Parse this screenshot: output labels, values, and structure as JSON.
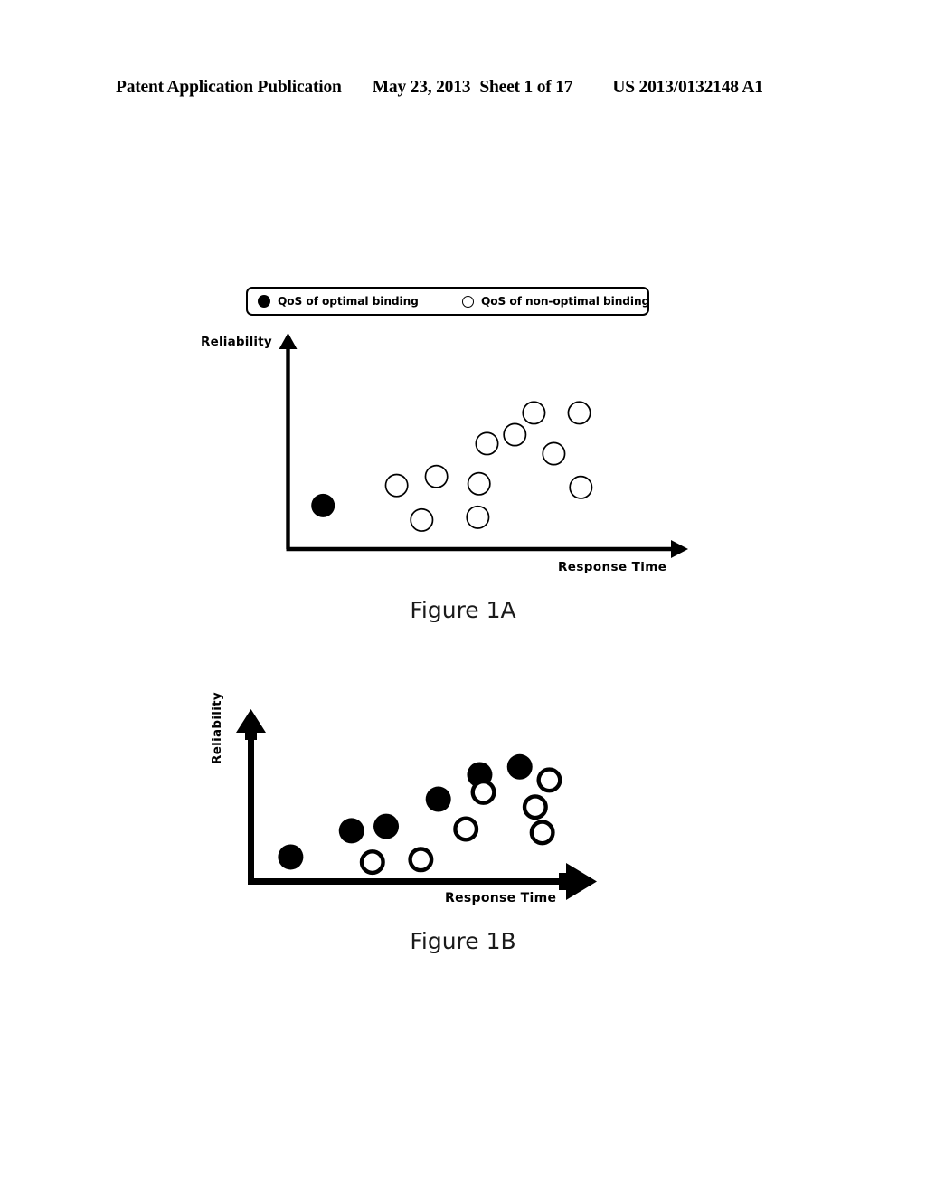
{
  "header": {
    "publication": "Patent Application Publication",
    "date": "May 23, 2013",
    "sheet": "Sheet 1 of 17",
    "patent_number": "US 2013/0132148 A1"
  },
  "legend": {
    "optimal_label": "QoS of optimal binding",
    "non_optimal_label": "QoS of non-optimal binding",
    "optimal_marker": "filled-circle",
    "non_optimal_marker": "open-circle"
  },
  "figures": [
    {
      "caption": "Figure 1A",
      "xlabel": "Response Time",
      "ylabel": "Reliability"
    },
    {
      "caption": "Figure 1B",
      "xlabel": "Response   Time",
      "ylabel": "Reliability"
    }
  ],
  "colors": {
    "ink": "#000000",
    "paper": "#ffffff"
  },
  "chart_data": [
    {
      "type": "scatter",
      "title": "Figure 1A",
      "xlabel": "Response Time",
      "ylabel": "Reliability",
      "grid": false,
      "axes": {
        "style": "arrow",
        "ticks": false,
        "xlim": [
          0,
          100
        ],
        "ylim": [
          0,
          100
        ]
      },
      "legend_position": "above-plot",
      "marker_radius_px": 13,
      "series": [
        {
          "name": "QoS of optimal binding",
          "marker": "filled-circle",
          "points": [
            {
              "x": 8.8,
              "y": 20.4
            }
          ]
        },
        {
          "name": "QoS of non-optimal binding",
          "marker": "open-circle",
          "points": [
            {
              "x": 27.3,
              "y": 29.8
            },
            {
              "x": 37.3,
              "y": 34.0
            },
            {
              "x": 33.6,
              "y": 13.6
            },
            {
              "x": 48.0,
              "y": 30.6
            },
            {
              "x": 47.7,
              "y": 14.9
            },
            {
              "x": 50.0,
              "y": 49.4
            },
            {
              "x": 57.0,
              "y": 53.6
            },
            {
              "x": 61.8,
              "y": 63.8
            },
            {
              "x": 66.8,
              "y": 44.7
            },
            {
              "x": 73.2,
              "y": 63.8
            },
            {
              "x": 73.6,
              "y": 28.9
            }
          ]
        }
      ]
    },
    {
      "type": "scatter",
      "title": "Figure 1B",
      "xlabel": "Response   Time",
      "ylabel": "Reliability",
      "grid": false,
      "axes": {
        "style": "arrow-bold",
        "ticks": false,
        "xlim": [
          0,
          100
        ],
        "ylim": [
          0,
          100
        ]
      },
      "legend_position": "none",
      "marker_radius_px": 14,
      "series": [
        {
          "name": "QoS of optimal binding",
          "marker": "filled-circle",
          "points": [
            {
              "x": 11.8,
              "y": 15.2
            },
            {
              "x": 29.9,
              "y": 31.5
            },
            {
              "x": 40.2,
              "y": 34.2
            },
            {
              "x": 55.7,
              "y": 51.1
            },
            {
              "x": 68.0,
              "y": 66.3
            },
            {
              "x": 79.9,
              "y": 71.2
            }
          ]
        },
        {
          "name": "QoS of non-optimal binding",
          "marker": "open-circle",
          "points": [
            {
              "x": 36.1,
              "y": 12.0
            },
            {
              "x": 50.5,
              "y": 13.6
            },
            {
              "x": 69.1,
              "y": 55.4
            },
            {
              "x": 63.9,
              "y": 32.6
            },
            {
              "x": 88.7,
              "y": 63.0
            },
            {
              "x": 84.5,
              "y": 46.2
            },
            {
              "x": 86.6,
              "y": 30.4
            }
          ]
        }
      ]
    }
  ]
}
